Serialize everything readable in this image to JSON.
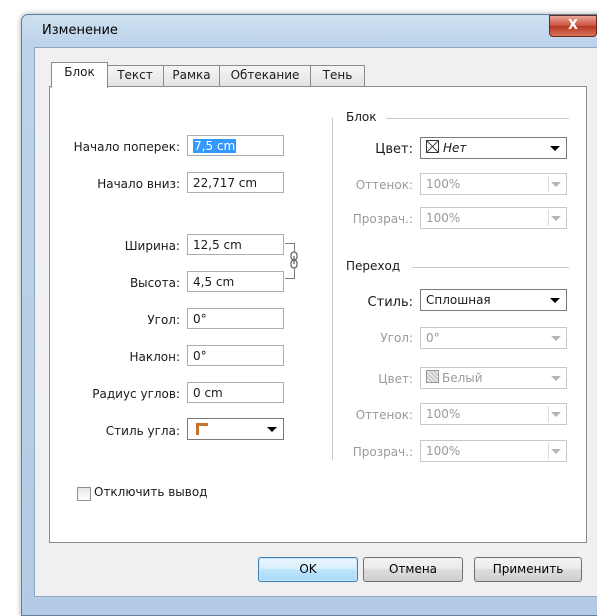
{
  "window": {
    "title": "Изменение",
    "close_glyph": "X"
  },
  "tabs": [
    "Блок",
    "Текст",
    "Рамка",
    "Обтекание",
    "Тень"
  ],
  "left": {
    "start_across": {
      "label": "Начало поперек:",
      "value": "7,5 cm"
    },
    "start_down": {
      "label": "Начало вниз:",
      "value": "22,717 cm"
    },
    "width": {
      "label": "Ширина:",
      "value": "12,5 cm"
    },
    "height": {
      "label": "Высота:",
      "value": "4,5 cm"
    },
    "angle": {
      "label": "Угол:",
      "value": "0°"
    },
    "skew": {
      "label": "Наклон:",
      "value": "0°"
    },
    "corner_radius": {
      "label": "Радиус углов:",
      "value": "0 cm"
    },
    "corner_style": {
      "label": "Стиль угла:",
      "value": ""
    },
    "disable_output": {
      "label": "Отключить вывод",
      "checked": false
    }
  },
  "block_group": {
    "title": "Блок",
    "color": {
      "label": "Цвет:",
      "value": "Нет"
    },
    "shade": {
      "label": "Оттенок:",
      "value": "100%"
    },
    "transparency": {
      "label": "Прозрач.:",
      "value": "100%"
    }
  },
  "gradient_group": {
    "title": "Переход",
    "style": {
      "label": "Стиль:",
      "value": "Сплошная"
    },
    "angle": {
      "label": "Угол:",
      "value": "0°"
    },
    "color": {
      "label": "Цвет:",
      "value": "Белый"
    },
    "shade": {
      "label": "Оттенок:",
      "value": "100%"
    },
    "transparency": {
      "label": "Прозрач.:",
      "value": "100%"
    }
  },
  "buttons": {
    "ok": "OK",
    "cancel": "Отмена",
    "apply": "Применить"
  },
  "colors": {
    "selection": "#3399ff",
    "titlebar": "#bcd3ea",
    "close_button": "#c7513c",
    "corner_icon": "#c5732e"
  }
}
